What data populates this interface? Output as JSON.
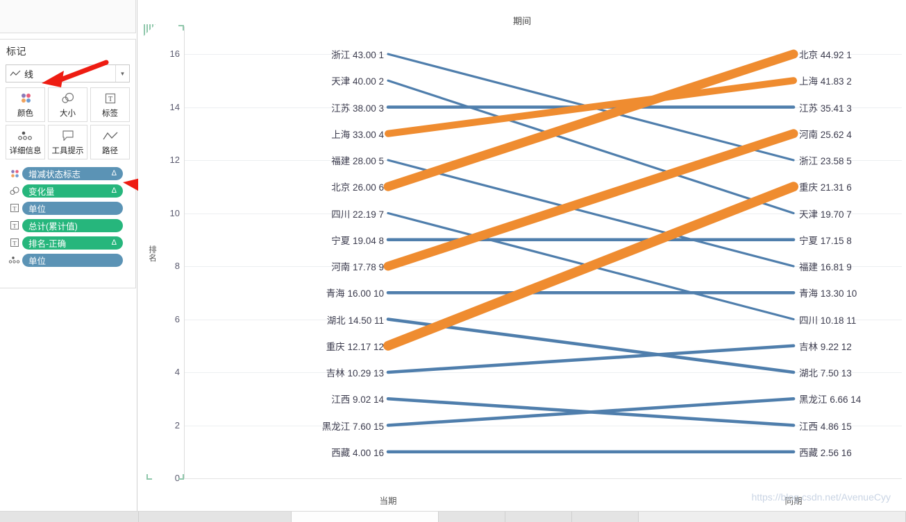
{
  "sidebar": {
    "marks_title": "标记",
    "mark_type": {
      "label": "线",
      "icon": "line-chart-icon",
      "caret": "▼"
    },
    "buttons": [
      {
        "label": "颜色",
        "icon": "color-dots-icon"
      },
      {
        "label": "大小",
        "icon": "size-circles-icon"
      },
      {
        "label": "标签",
        "icon": "label-T-icon"
      },
      {
        "label": "详细信息",
        "icon": "detail-dots-icon"
      },
      {
        "label": "工具提示",
        "icon": "tooltip-bubble-icon"
      },
      {
        "label": "路径",
        "icon": "path-line-icon"
      }
    ],
    "pills": [
      {
        "label": "增减状态标志",
        "delta": "Δ",
        "color": "blue",
        "icon": "color-dots-icon"
      },
      {
        "label": "变化量",
        "delta": "Δ",
        "color": "green",
        "icon": "size-circles-icon"
      },
      {
        "label": "单位",
        "delta": "",
        "color": "blue",
        "icon": "label-T-icon"
      },
      {
        "label": "总计(累计值)",
        "delta": "",
        "color": "green",
        "icon": "label-T-icon"
      },
      {
        "label": "排名-正确",
        "delta": "Δ",
        "color": "green",
        "icon": "label-T-icon"
      },
      {
        "label": "单位",
        "delta": "",
        "color": "blue",
        "icon": "detail-dots-icon"
      }
    ]
  },
  "chart_data": {
    "type": "line",
    "title": "期间",
    "xlabel": "",
    "ylabel": "排名",
    "categories": [
      "当期",
      "同期"
    ],
    "yticks": [
      0,
      2,
      4,
      6,
      8,
      10,
      12,
      14,
      16
    ],
    "ylim": [
      0,
      16
    ],
    "grid": true,
    "colors": {
      "increase": "#ef8c30",
      "decrease": "#4f7eac"
    },
    "left_labels": [
      {
        "name": "浙江",
        "value": "43.00",
        "rank": "1",
        "text": "浙江 43.00 1"
      },
      {
        "name": "天津",
        "value": "40.00",
        "rank": "2",
        "text": "天津 40.00 2"
      },
      {
        "name": "江苏",
        "value": "38.00",
        "rank": "3",
        "text": "江苏 38.00 3"
      },
      {
        "name": "上海",
        "value": "33.00",
        "rank": "4",
        "text": "上海 33.00 4"
      },
      {
        "name": "福建",
        "value": "28.00",
        "rank": "5",
        "text": "福建 28.00 5"
      },
      {
        "name": "北京",
        "value": "26.00",
        "rank": "6",
        "text": "北京 26.00 6"
      },
      {
        "name": "四川",
        "value": "22.19",
        "rank": "7",
        "text": "四川 22.19 7"
      },
      {
        "name": "宁夏",
        "value": "19.04",
        "rank": "8",
        "text": "宁夏 19.04 8"
      },
      {
        "name": "河南",
        "value": "17.78",
        "rank": "9",
        "text": "河南 17.78 9"
      },
      {
        "name": "青海",
        "value": "16.00",
        "rank": "10",
        "text": "青海 16.00 10"
      },
      {
        "name": "湖北",
        "value": "14.50",
        "rank": "11",
        "text": "湖北 14.50 11"
      },
      {
        "name": "重庆",
        "value": "12.17",
        "rank": "12",
        "text": "重庆 12.17 12"
      },
      {
        "name": "吉林",
        "value": "10.29",
        "rank": "13",
        "text": "吉林 10.29 13"
      },
      {
        "name": "江西",
        "value": "9.02",
        "rank": "14",
        "text": "江西 9.02 14"
      },
      {
        "name": "黑龙江",
        "value": "7.60",
        "rank": "15",
        "text": "黑龙江 7.60 15"
      },
      {
        "name": "西藏",
        "value": "4.00",
        "rank": "16",
        "text": "西藏 4.00 16"
      }
    ],
    "right_labels": [
      {
        "name": "北京",
        "value": "44.92",
        "rank": "1",
        "text": "北京 44.92 1"
      },
      {
        "name": "上海",
        "value": "41.83",
        "rank": "2",
        "text": "上海 41.83 2"
      },
      {
        "name": "江苏",
        "value": "35.41",
        "rank": "3",
        "text": "江苏 35.41 3"
      },
      {
        "name": "河南",
        "value": "25.62",
        "rank": "4",
        "text": "河南 25.62 4"
      },
      {
        "name": "浙江",
        "value": "23.58",
        "rank": "5",
        "text": "浙江 23.58 5"
      },
      {
        "name": "重庆",
        "value": "21.31",
        "rank": "6",
        "text": "重庆 21.31 6"
      },
      {
        "name": "天津",
        "value": "19.70",
        "rank": "7",
        "text": "天津 19.70 7"
      },
      {
        "name": "宁夏",
        "value": "17.15",
        "rank": "8",
        "text": "宁夏 17.15 8"
      },
      {
        "name": "福建",
        "value": "16.81",
        "rank": "9",
        "text": "福建 16.81 9"
      },
      {
        "name": "青海",
        "value": "13.30",
        "rank": "10",
        "text": "青海 13.30 10"
      },
      {
        "name": "四川",
        "value": "10.18",
        "rank": "11",
        "text": "四川 10.18 11"
      },
      {
        "name": "吉林",
        "value": "9.22",
        "rank": "12",
        "text": "吉林 9.22 12"
      },
      {
        "name": "湖北",
        "value": "7.50",
        "rank": "13",
        "text": "湖北 7.50 13"
      },
      {
        "name": "黑龙江",
        "value": "6.66",
        "rank": "14",
        "text": "黑龙江 6.66 14"
      },
      {
        "name": "江西",
        "value": "4.86",
        "rank": "15",
        "text": "江西 4.86 15"
      },
      {
        "name": "西藏",
        "value": "2.56",
        "rank": "16",
        "text": "西藏 2.56 16"
      }
    ],
    "series": [
      {
        "name": "浙江",
        "left_rank": 1,
        "right_rank": 5,
        "left_value": 43.0,
        "right_value": 23.58,
        "direction": "decrease"
      },
      {
        "name": "天津",
        "left_rank": 2,
        "right_rank": 7,
        "left_value": 40.0,
        "right_value": 19.7,
        "direction": "decrease"
      },
      {
        "name": "江苏",
        "left_rank": 3,
        "right_rank": 3,
        "left_value": 38.0,
        "right_value": 35.41,
        "direction": "decrease"
      },
      {
        "name": "上海",
        "left_rank": 4,
        "right_rank": 2,
        "left_value": 33.0,
        "right_value": 41.83,
        "direction": "increase"
      },
      {
        "name": "福建",
        "left_rank": 5,
        "right_rank": 9,
        "left_value": 28.0,
        "right_value": 16.81,
        "direction": "decrease"
      },
      {
        "name": "北京",
        "left_rank": 6,
        "right_rank": 1,
        "left_value": 26.0,
        "right_value": 44.92,
        "direction": "increase"
      },
      {
        "name": "四川",
        "left_rank": 7,
        "right_rank": 11,
        "left_value": 22.19,
        "right_value": 10.18,
        "direction": "decrease"
      },
      {
        "name": "宁夏",
        "left_rank": 8,
        "right_rank": 8,
        "left_value": 19.04,
        "right_value": 17.15,
        "direction": "decrease"
      },
      {
        "name": "河南",
        "left_rank": 9,
        "right_rank": 4,
        "left_value": 17.78,
        "right_value": 25.62,
        "direction": "increase"
      },
      {
        "name": "青海",
        "left_rank": 10,
        "right_rank": 10,
        "left_value": 16.0,
        "right_value": 13.3,
        "direction": "decrease"
      },
      {
        "name": "湖北",
        "left_rank": 11,
        "right_rank": 13,
        "left_value": 14.5,
        "right_value": 7.5,
        "direction": "decrease"
      },
      {
        "name": "重庆",
        "left_rank": 12,
        "right_rank": 6,
        "left_value": 12.17,
        "right_value": 21.31,
        "direction": "increase"
      },
      {
        "name": "吉林",
        "left_rank": 13,
        "right_rank": 12,
        "left_value": 10.29,
        "right_value": 9.22,
        "direction": "decrease"
      },
      {
        "name": "江西",
        "left_rank": 14,
        "right_rank": 15,
        "left_value": 9.02,
        "right_value": 4.86,
        "direction": "decrease"
      },
      {
        "name": "黑龙江",
        "left_rank": 15,
        "right_rank": 14,
        "left_value": 7.6,
        "right_value": 6.66,
        "direction": "decrease"
      },
      {
        "name": "西藏",
        "left_rank": 16,
        "right_rank": 16,
        "left_value": 4.0,
        "right_value": 2.56,
        "direction": "decrease"
      }
    ]
  },
  "watermark": "https://blog.csdn.net/AvenueCyy"
}
